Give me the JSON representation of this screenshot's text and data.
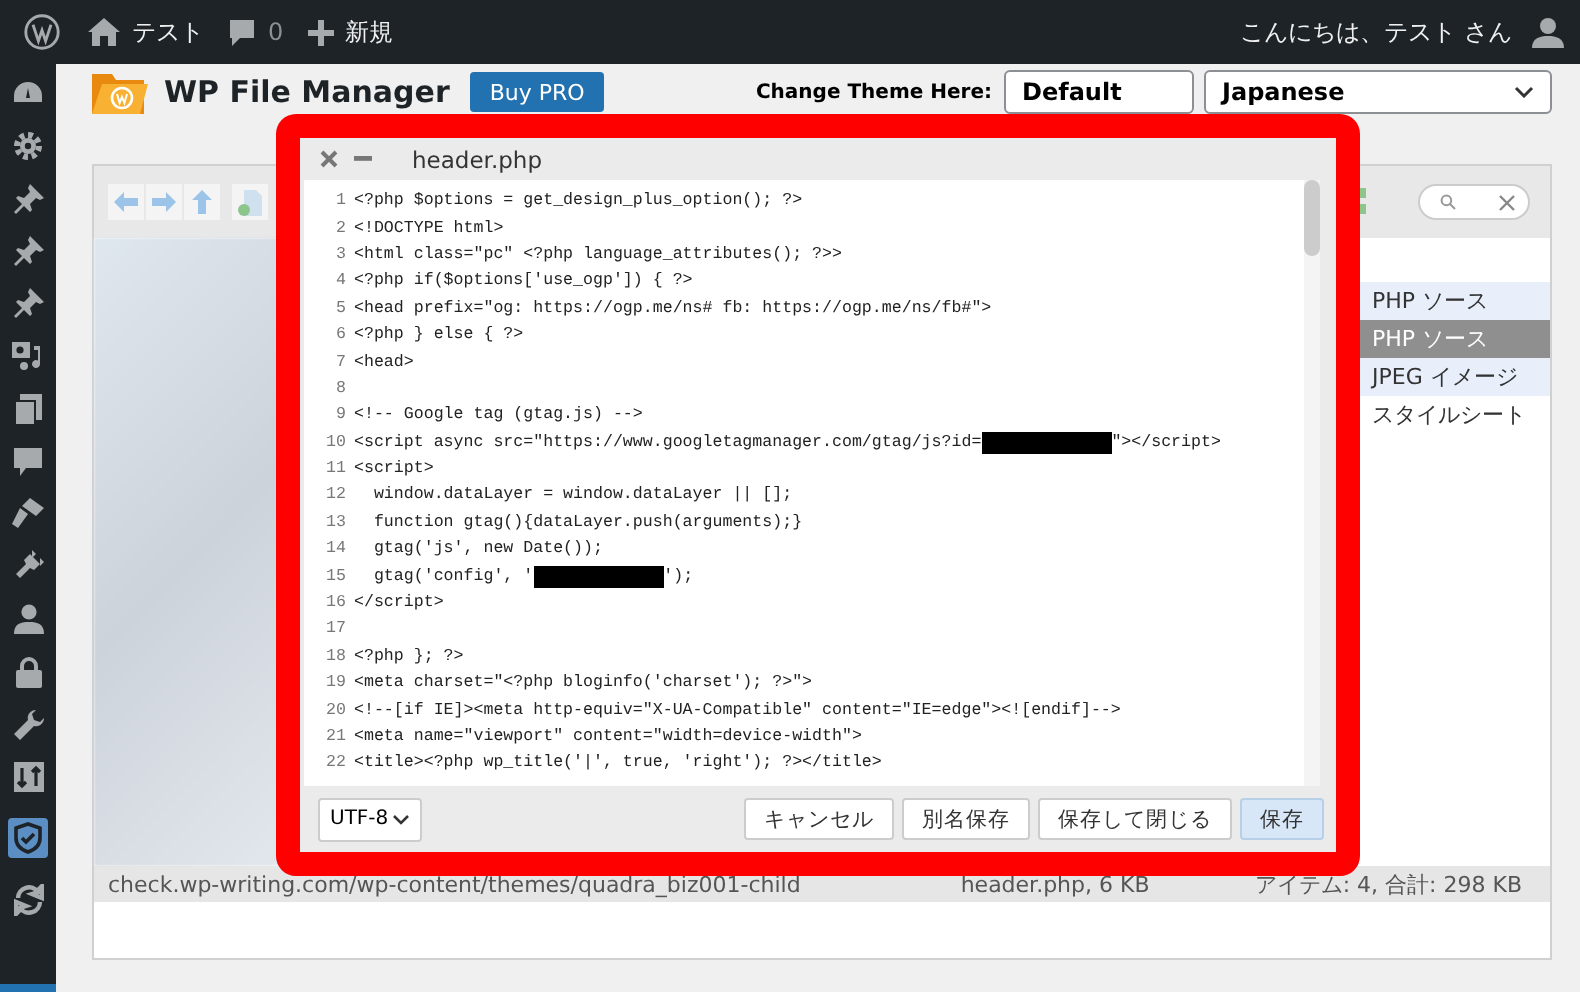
{
  "admin_bar": {
    "site_name": "テスト",
    "comment_count": "0",
    "new_label": "新規",
    "greeting": "こんにちは、テスト さん"
  },
  "header": {
    "title": "WP File Manager",
    "buy_button": "Buy PRO",
    "theme_label": "Change Theme Here:",
    "theme_select": "Default",
    "language_select": "Japanese"
  },
  "file_list": [
    {
      "label": "PHP ソース",
      "selected": false
    },
    {
      "label": "PHP ソース",
      "selected": true
    },
    {
      "label": "JPEG イメージ",
      "selected": false
    },
    {
      "label": "スタイルシート",
      "selected": false
    }
  ],
  "status_bar": {
    "path": "check.wp-writing.com/wp-content/themes/quadra_biz001-child",
    "file_info": "header.php, 6 KB",
    "summary": "アイテム: 4, 合計: 298 KB"
  },
  "editor": {
    "title": "header.php",
    "lines": [
      {
        "number": "1",
        "code": "<?php $options = get_design_plus_option(); ?>"
      },
      {
        "number": "2",
        "code": "<!DOCTYPE html>"
      },
      {
        "number": "3",
        "code": "<html class=\"pc\" <?php language_attributes(); ?>>"
      },
      {
        "number": "4",
        "code": "<?php if($options['use_ogp']) { ?>"
      },
      {
        "number": "5",
        "code": "<head prefix=\"og: https://ogp.me/ns# fb: https://ogp.me/ns/fb#\">"
      },
      {
        "number": "6",
        "code": "<?php } else { ?>"
      },
      {
        "number": "7",
        "code": "<head>"
      },
      {
        "number": "8"
      },
      {
        "number": "9",
        "code": "<!-- Google tag (gtag.js) -->"
      },
      {
        "number": "10",
        "code": "<script async src=\"https://www.googletagmanager.com/gtag/js?id=",
        "redacted": true,
        "code_after": "\"></script>"
      },
      {
        "number": "11",
        "code": "<script>"
      },
      {
        "number": "12",
        "code": "  window.dataLayer = window.dataLayer || [];"
      },
      {
        "number": "13",
        "code": "  function gtag(){dataLayer.push(arguments);}"
      },
      {
        "number": "14",
        "code": "  gtag('js', new Date());"
      },
      {
        "number": "15",
        "code": "  gtag('config', '",
        "redacted": true,
        "code_after": "');"
      },
      {
        "number": "16",
        "code": "</script>"
      },
      {
        "number": "17"
      },
      {
        "number": "18",
        "code": "<?php }; ?>"
      },
      {
        "number": "19",
        "code": "<meta charset=\"<?php bloginfo('charset'); ?>\">"
      },
      {
        "number": "20",
        "code": "<!--[if IE]><meta http-equiv=\"X-UA-Compatible\" content=\"IE=edge\"><![endif]-->"
      },
      {
        "number": "21",
        "code": "<meta name=\"viewport\" content=\"width=device-width\">"
      },
      {
        "number": "22",
        "code": "<title><?php wp_title('|', true, 'right'); ?></title>"
      }
    ],
    "encoding": "UTF-8",
    "buttons": [
      {
        "label": "キャンセル",
        "primary": false
      },
      {
        "label": "別名保存",
        "primary": false
      },
      {
        "label": "保存して閉じる",
        "primary": false
      },
      {
        "label": "保存",
        "primary": true
      }
    ]
  }
}
